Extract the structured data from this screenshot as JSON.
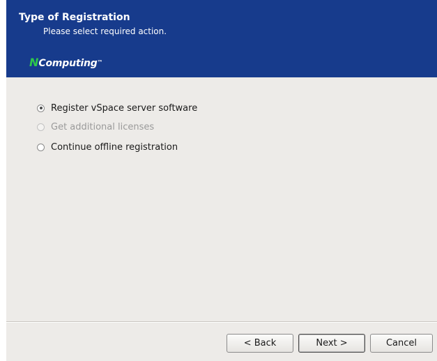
{
  "header": {
    "title": "Type of Registration",
    "subtitle": "Please select required action.",
    "logo_mark": "N",
    "logo_text": "Computing",
    "logo_tm": "™",
    "background_color": "#173b8c",
    "logo_accent_color": "#2ec84a"
  },
  "options": [
    {
      "label": "Register vSpace server software",
      "selected": true,
      "enabled": true
    },
    {
      "label": "Get additional licenses",
      "selected": false,
      "enabled": false
    },
    {
      "label": "Continue offline registration",
      "selected": false,
      "enabled": true
    }
  ],
  "buttons": {
    "back_label": "< Back",
    "next_label": "Next >",
    "cancel_label": "Cancel"
  }
}
